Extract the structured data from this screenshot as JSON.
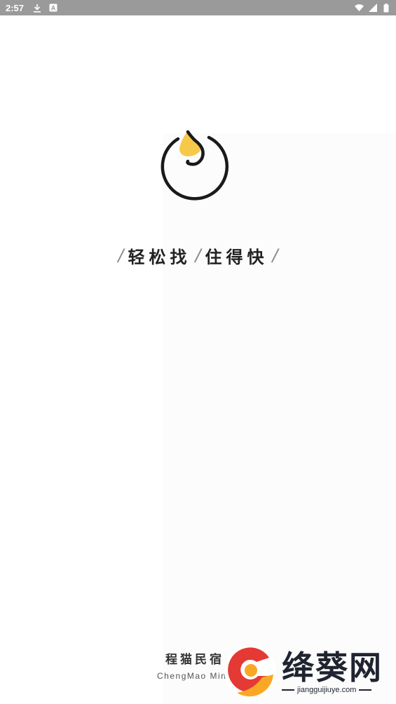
{
  "status_bar": {
    "time": "2:57",
    "left_icons": [
      "download-icon",
      "a-badge-icon"
    ],
    "right_icons": [
      "wifi-icon",
      "signal-icon",
      "battery-icon"
    ],
    "background": "#9a9a9a"
  },
  "splash": {
    "logo_accent_color": "#f6c94a",
    "logo_stroke_color": "#1a1a1a",
    "slogan_part1": "轻松找",
    "slogan_part2": "住得快",
    "slash": "/"
  },
  "footer": {
    "brand_cn": "程猫民宿",
    "brand_en": "ChengMao Minsu"
  },
  "watermark": {
    "text": "绛葵网",
    "url": "jiangguijiuye.com",
    "colors": [
      "#e53935",
      "#f9a825"
    ]
  }
}
